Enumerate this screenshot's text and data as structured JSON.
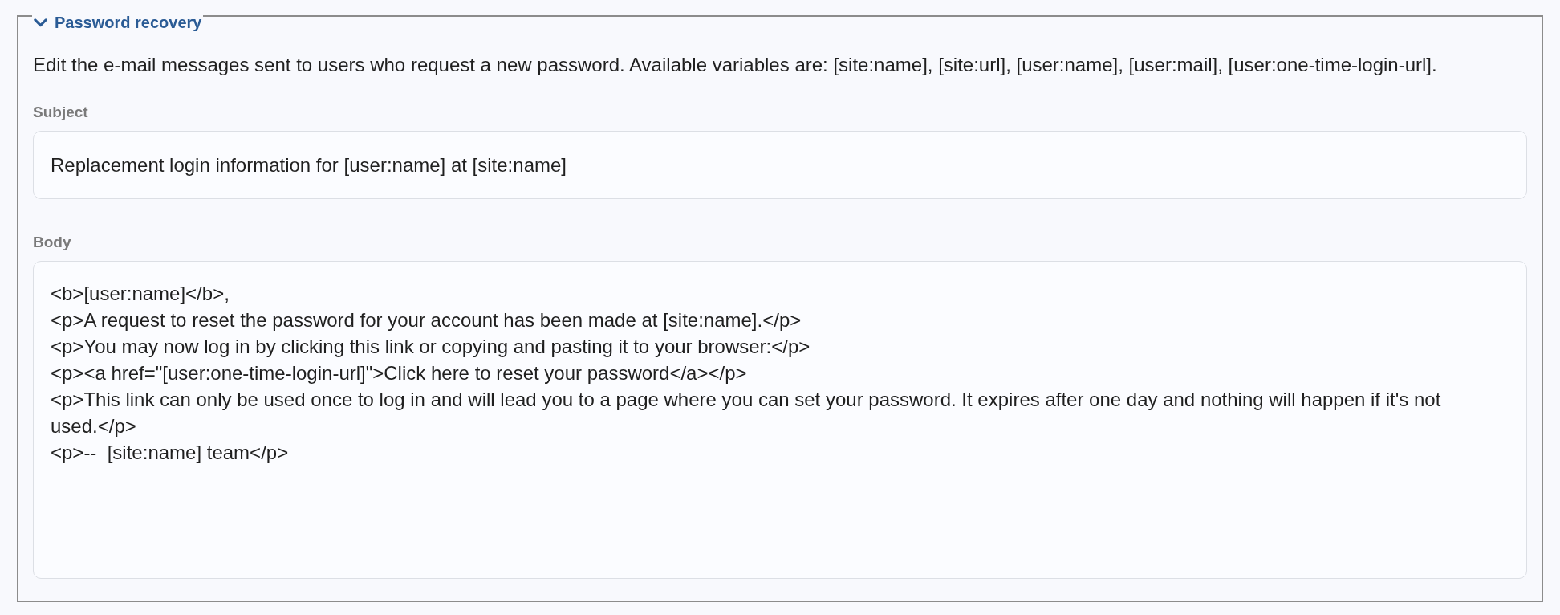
{
  "fieldset": {
    "legend": "Password recovery",
    "expanded": true
  },
  "description": "Edit the e-mail messages sent to users who request a new password. Available variables are: [site:name], [site:url], [user:name], [user:mail], [user:one-time-login-url].",
  "fields": [
    {
      "kind": "input",
      "label": "Subject",
      "value": "Replacement login information for [user:name] at [site:name]"
    },
    {
      "kind": "textarea",
      "label": "Body",
      "value": [
        "<b>[user:name]</b>,",
        "<p>A request to reset the password for your account has been made at [site:name].</p>",
        "<p>You may now log in by clicking this link or copying and pasting it to your browser:</p>",
        "<p><a href=\"[user:one-time-login-url]\">Click here to reset your password</a></p>",
        "<p>This link can only be used once to log in and will lead you to a page where you can set your password. It expires after one day and nothing will happen if it's not used.</p>",
        "<p>--  [site:name] team</p>"
      ]
    }
  ]
}
